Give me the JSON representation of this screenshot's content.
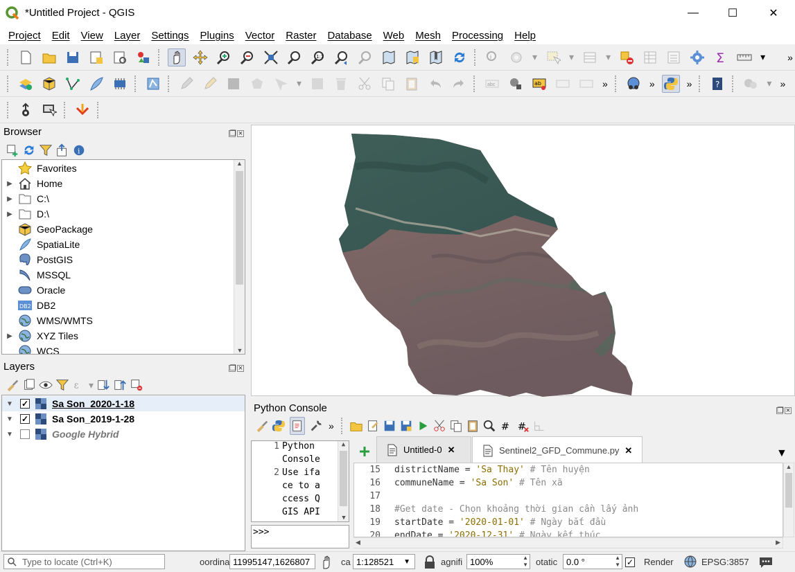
{
  "window": {
    "title": "*Untitled Project - QGIS",
    "minimize": "—",
    "maximize": "☐",
    "close": "✕"
  },
  "menu": [
    "Project",
    "Edit",
    "View",
    "Layer",
    "Settings",
    "Plugins",
    "Vector",
    "Raster",
    "Database",
    "Web",
    "Mesh",
    "Processing",
    "Help"
  ],
  "browser": {
    "title": "Browser",
    "items": [
      {
        "label": "Favorites",
        "expandable": false,
        "icon": "star-icon"
      },
      {
        "label": "Home",
        "expandable": true,
        "icon": "home-icon"
      },
      {
        "label": "C:\\",
        "expandable": true,
        "icon": "folder-icon"
      },
      {
        "label": "D:\\",
        "expandable": true,
        "icon": "folder-icon"
      },
      {
        "label": "GeoPackage",
        "expandable": false,
        "icon": "geopackage-icon"
      },
      {
        "label": "SpatiaLite",
        "expandable": false,
        "icon": "spatialite-icon"
      },
      {
        "label": "PostGIS",
        "expandable": false,
        "icon": "postgis-icon"
      },
      {
        "label": "MSSQL",
        "expandable": false,
        "icon": "mssql-icon"
      },
      {
        "label": "Oracle",
        "expandable": false,
        "icon": "oracle-icon"
      },
      {
        "label": "DB2",
        "expandable": false,
        "icon": "db2-icon"
      },
      {
        "label": "WMS/WMTS",
        "expandable": false,
        "icon": "globe-icon"
      },
      {
        "label": "XYZ Tiles",
        "expandable": true,
        "icon": "globe-icon"
      },
      {
        "label": "WCS",
        "expandable": false,
        "icon": "globe-icon"
      }
    ]
  },
  "layers": {
    "title": "Layers",
    "items": [
      {
        "label": "Sa Son_2020-1-18",
        "checked": true
      },
      {
        "label": "Sa Son_2019-1-28",
        "checked": true
      },
      {
        "label": "Google Hybrid",
        "checked": false
      }
    ]
  },
  "python_console": {
    "title": "Python Console",
    "left_lines": [
      {
        "num": "1",
        "text": "Python"
      },
      {
        "num": "",
        "text": "Console"
      },
      {
        "num": "2",
        "text": "Use ifa"
      },
      {
        "num": "",
        "text": "ce to a"
      },
      {
        "num": "",
        "text": "ccess Q"
      },
      {
        "num": "",
        "text": "GIS API"
      }
    ],
    "prompt": ">>>",
    "tabs": [
      {
        "label": "Untitled-0",
        "close": "✕"
      },
      {
        "label": "Sentinel2_GFD_Commune.py",
        "close": "✕"
      }
    ],
    "editor_lines": [
      {
        "num": "15",
        "code": "districtName = ",
        "str": "'Sa Thay'",
        "cmt": " # Tên huyện"
      },
      {
        "num": "16",
        "code": "communeName = ",
        "str": "'Sa Son'",
        "cmt": " # Tên xã"
      },
      {
        "num": "17",
        "code": "",
        "str": "",
        "cmt": ""
      },
      {
        "num": "18",
        "code": "",
        "str": "",
        "cmt": "#Get date - Chọn khoảng thời gian cần lấy ảnh"
      },
      {
        "num": "19",
        "code": "startDate = ",
        "str": "'2020-01-01'",
        "cmt": " # Ngày bắt đầu"
      },
      {
        "num": "20",
        "code": "endDate = ",
        "str": "'2020-12-31'",
        "cmt": " # Ngày kết thúc"
      }
    ]
  },
  "status": {
    "locate_placeholder": "Type to locate (Ctrl+K)",
    "coordinate_label": "oordina",
    "coordinate": "11995147,1626807",
    "scale_label": "ca",
    "scale": "1:128521",
    "magnifier_label": "agnifi",
    "magnifier": "100%",
    "rotation_label": "otatic",
    "rotation": "0.0 °",
    "render_label": "Render",
    "crs": "EPSG:3857"
  }
}
